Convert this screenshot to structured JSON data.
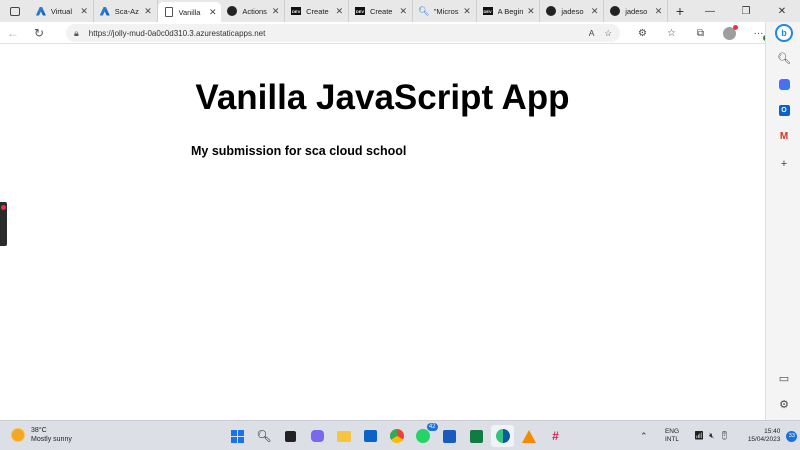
{
  "browser": {
    "tabs": [
      {
        "title": "Virtual",
        "icon": "azure-icon"
      },
      {
        "title": "Sca-Az",
        "icon": "azure-icon"
      },
      {
        "title": "Vanilla",
        "icon": "page-icon",
        "active": true
      },
      {
        "title": "Actions",
        "icon": "github-icon"
      },
      {
        "title": "Create",
        "icon": "dev-icon"
      },
      {
        "title": "Create",
        "icon": "dev-icon"
      },
      {
        "title": "\"Micros",
        "icon": "search-icon"
      },
      {
        "title": "A Begin",
        "icon": "dev-icon"
      },
      {
        "title": "jadeso",
        "icon": "github-icon"
      },
      {
        "title": "jadeso",
        "icon": "github-icon"
      }
    ],
    "address_url": "https://jolly-mud-0a0c0d310.3.azurestaticapps.net"
  },
  "page": {
    "heading": "Vanilla JavaScript App",
    "subheading": "My submission for sca cloud school"
  },
  "taskbar": {
    "weather_temp": "38°C",
    "weather_desc": "Mostly sunny",
    "whatsapp_badge": "42",
    "lang_top": "ENG",
    "lang_bottom": "INTL",
    "time": "15:40",
    "date": "15/04/2023",
    "notification_count": "33"
  },
  "colors": {
    "edge_accent": "#1e88e5",
    "taskbar_bg": "#dcdfe6",
    "tabstrip_bg": "#e8e8e8"
  }
}
